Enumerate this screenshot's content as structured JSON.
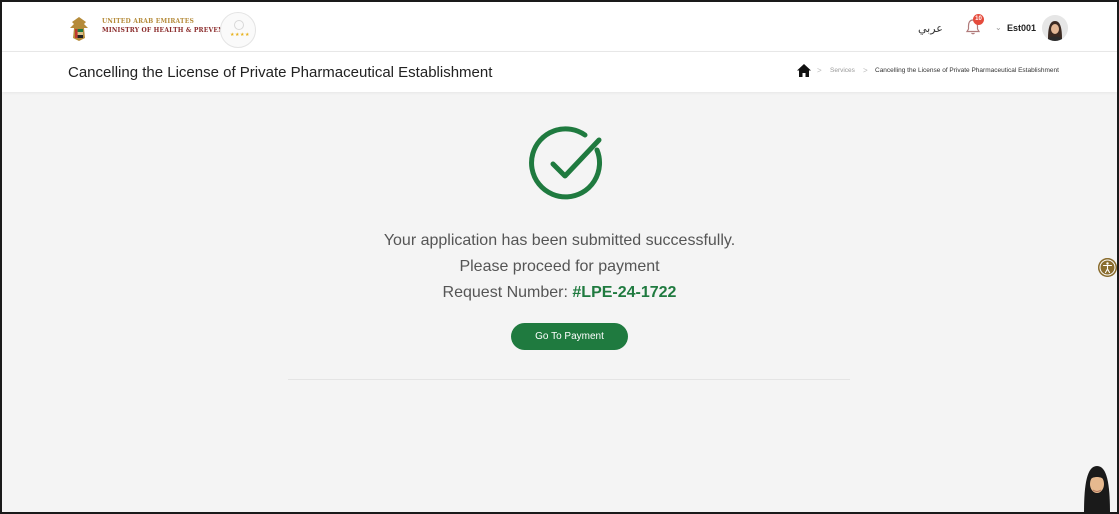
{
  "header": {
    "ministry_line1": "UNITED ARAB EMIRATES",
    "ministry_line2": "MINISTRY OF HEALTH & PREVENTION",
    "language_toggle": "عربي",
    "notification_count": "10",
    "username": "Est001"
  },
  "page": {
    "title": "Cancelling the License of Private Pharmaceutical Establishment"
  },
  "breadcrumb": {
    "services": "Services",
    "current": "Cancelling the License of Private Pharmaceutical Establishment"
  },
  "confirmation": {
    "line1": "Your application has been submitted successfully.",
    "line2": "Please proceed for payment",
    "request_label": "Request Number:",
    "request_number": "#LPE-24-1722",
    "button_label": "Go To Payment"
  },
  "colors": {
    "accent_green": "#1f7a3f",
    "notification_red": "#e54b3c",
    "accessibility_gold": "#8a6d2f"
  },
  "icons": [
    "home-icon",
    "bell-icon",
    "chevron-down-icon",
    "check-circle-icon",
    "accessibility-icon"
  ]
}
